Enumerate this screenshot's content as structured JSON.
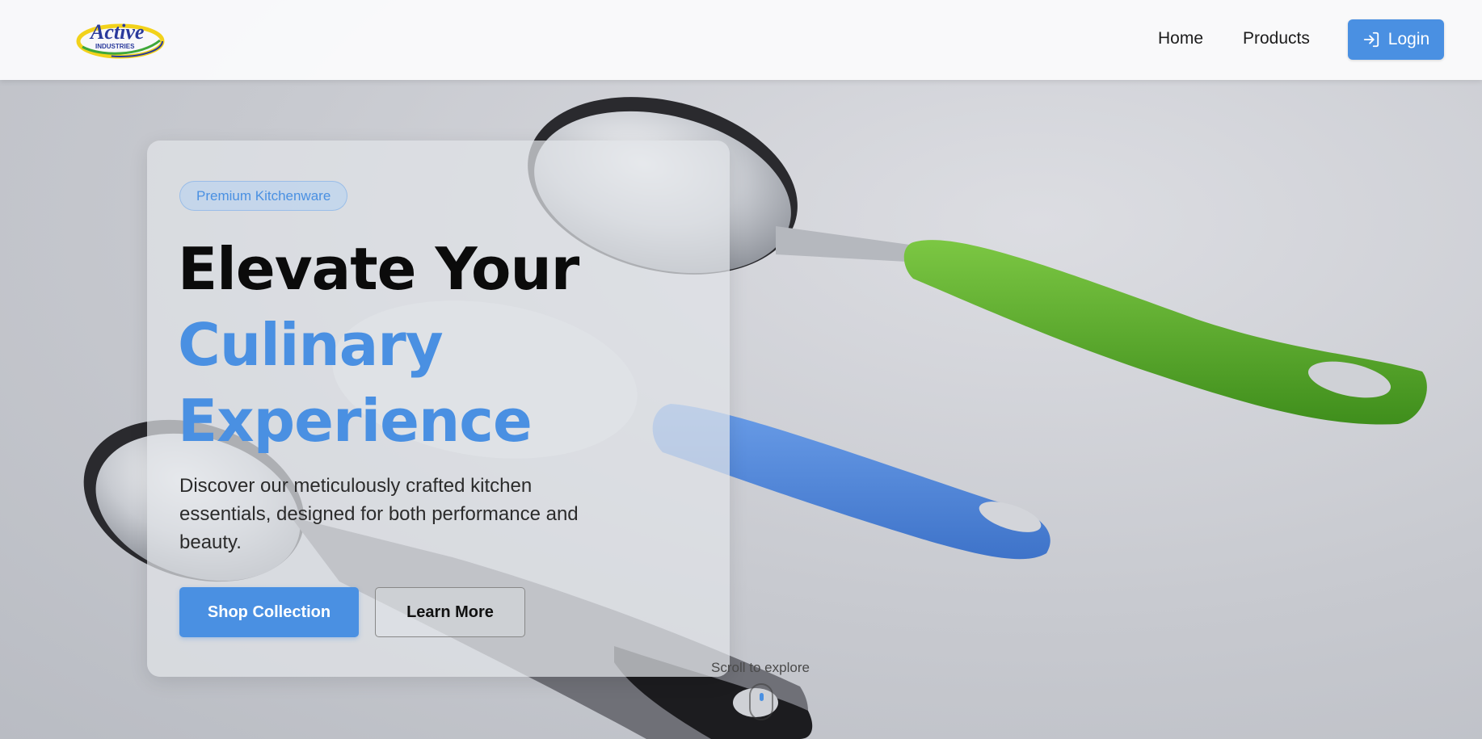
{
  "header": {
    "logo_text": "Active",
    "logo_subtext": "INDUSTRIES",
    "nav": [
      {
        "label": "Home"
      },
      {
        "label": "Products"
      }
    ],
    "login_label": "Login",
    "login_icon": "login-icon"
  },
  "hero": {
    "badge": "Premium Kitchenware",
    "headline_line1": "Elevate Your",
    "headline_line2": "Culinary",
    "headline_line3": "Experience",
    "description": "Discover our meticulously crafted kitchen essentials, designed for both performance and beauty.",
    "primary_button": "Shop Collection",
    "secondary_button": "Learn More",
    "scroll_hint": "Scroll to explore"
  },
  "colors": {
    "accent": "#4a90e2",
    "handle_green": "#5aab2e",
    "handle_blue": "#4f86d9",
    "text_dark": "#0b0b0b"
  }
}
